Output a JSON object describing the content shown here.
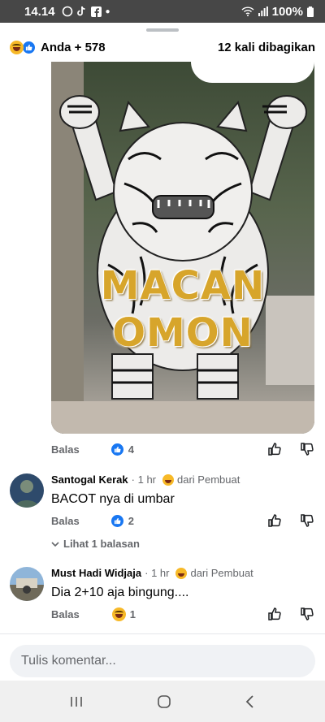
{
  "status_bar": {
    "time": "14.14",
    "battery": "100%"
  },
  "header": {
    "reactors": "Anda + 578",
    "shares": "12 kali dibagikan"
  },
  "post": {
    "meme_line1": "MACAN",
    "meme_line2": "OMON",
    "reply_label": "Balas",
    "like_count": "4"
  },
  "comments": [
    {
      "name": "Santogal Kerak",
      "time": "· 1 hr",
      "origin": "dari Pembuat",
      "text": "BACOT nya di umbar",
      "reply_label": "Balas",
      "reaction_count": "2",
      "view_replies": "Lihat 1 balasan"
    },
    {
      "name": "Must Hadi Widjaja",
      "time": "· 1 hr",
      "origin": "dari Pembuat",
      "text": "Dia 2+10 aja bingung....",
      "reply_label": "Balas",
      "reaction_count": "1"
    }
  ],
  "input": {
    "placeholder": "Tulis komentar..."
  },
  "colors": {
    "accent": "#1877f2",
    "haha": "#f7b928",
    "meme_gold": "#d7a52b"
  }
}
